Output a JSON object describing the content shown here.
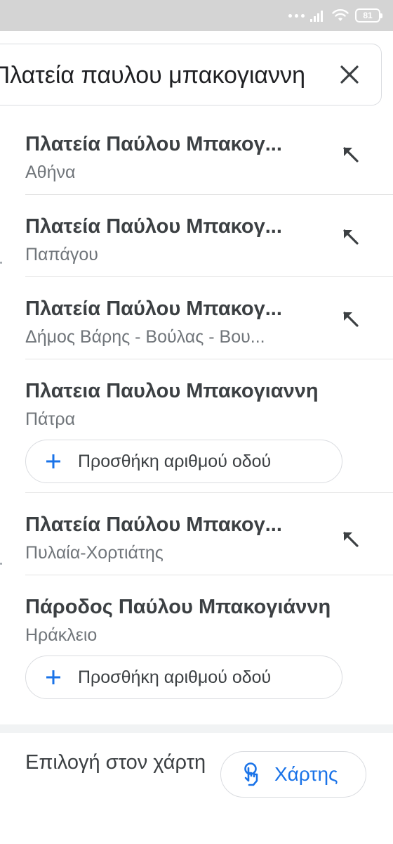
{
  "status_bar": {
    "battery_level": "81",
    "icons": [
      "dots-icon",
      "signal-icon",
      "wifi-icon",
      "battery-icon"
    ]
  },
  "search": {
    "query": "Πλατεία παυλου μπακογιαννη",
    "clear_icon": "close-icon"
  },
  "results": [
    {
      "title": "Πλατεία Παύλου Μπακογ...",
      "subtitle": "Αθήνα",
      "action_icon": "arrow-up-left-icon"
    },
    {
      "title": "Πλατεία Παύλου Μπακογ...",
      "subtitle": "Παπάγου",
      "action_icon": "arrow-up-left-icon"
    },
    {
      "title": "Πλατεία Παύλου Μπακογ...",
      "subtitle": "Δήμος Βάρης - Βούλας - Βου...",
      "action_icon": "arrow-up-left-icon"
    },
    {
      "title": "Πλατεια Παυλου Μπακογιαννη",
      "subtitle": "Πάτρα",
      "add_button": "Προσθήκη αριθμού οδού"
    },
    {
      "title": "Πλατεία Παύλου Μπακογ...",
      "subtitle": "Πυλαία-Χορτιάτης",
      "action_icon": "arrow-up-left-icon"
    },
    {
      "title": "Πάροδος Παύλου Μπακογιάννη",
      "subtitle": "Ηράκλειο",
      "add_button": "Προσθήκη αριθμού οδού"
    }
  ],
  "bottom": {
    "pick_on_map_text": "Επιλογή στον χάρτη",
    "map_button_label": "Χάρτης",
    "map_button_icon": "touch-hand-icon"
  },
  "colors": {
    "accent_blue": "#1a73e8",
    "title_text": "#3c4043",
    "subtitle_text": "#70757a",
    "status_bar_bg": "#d4d4d4"
  }
}
